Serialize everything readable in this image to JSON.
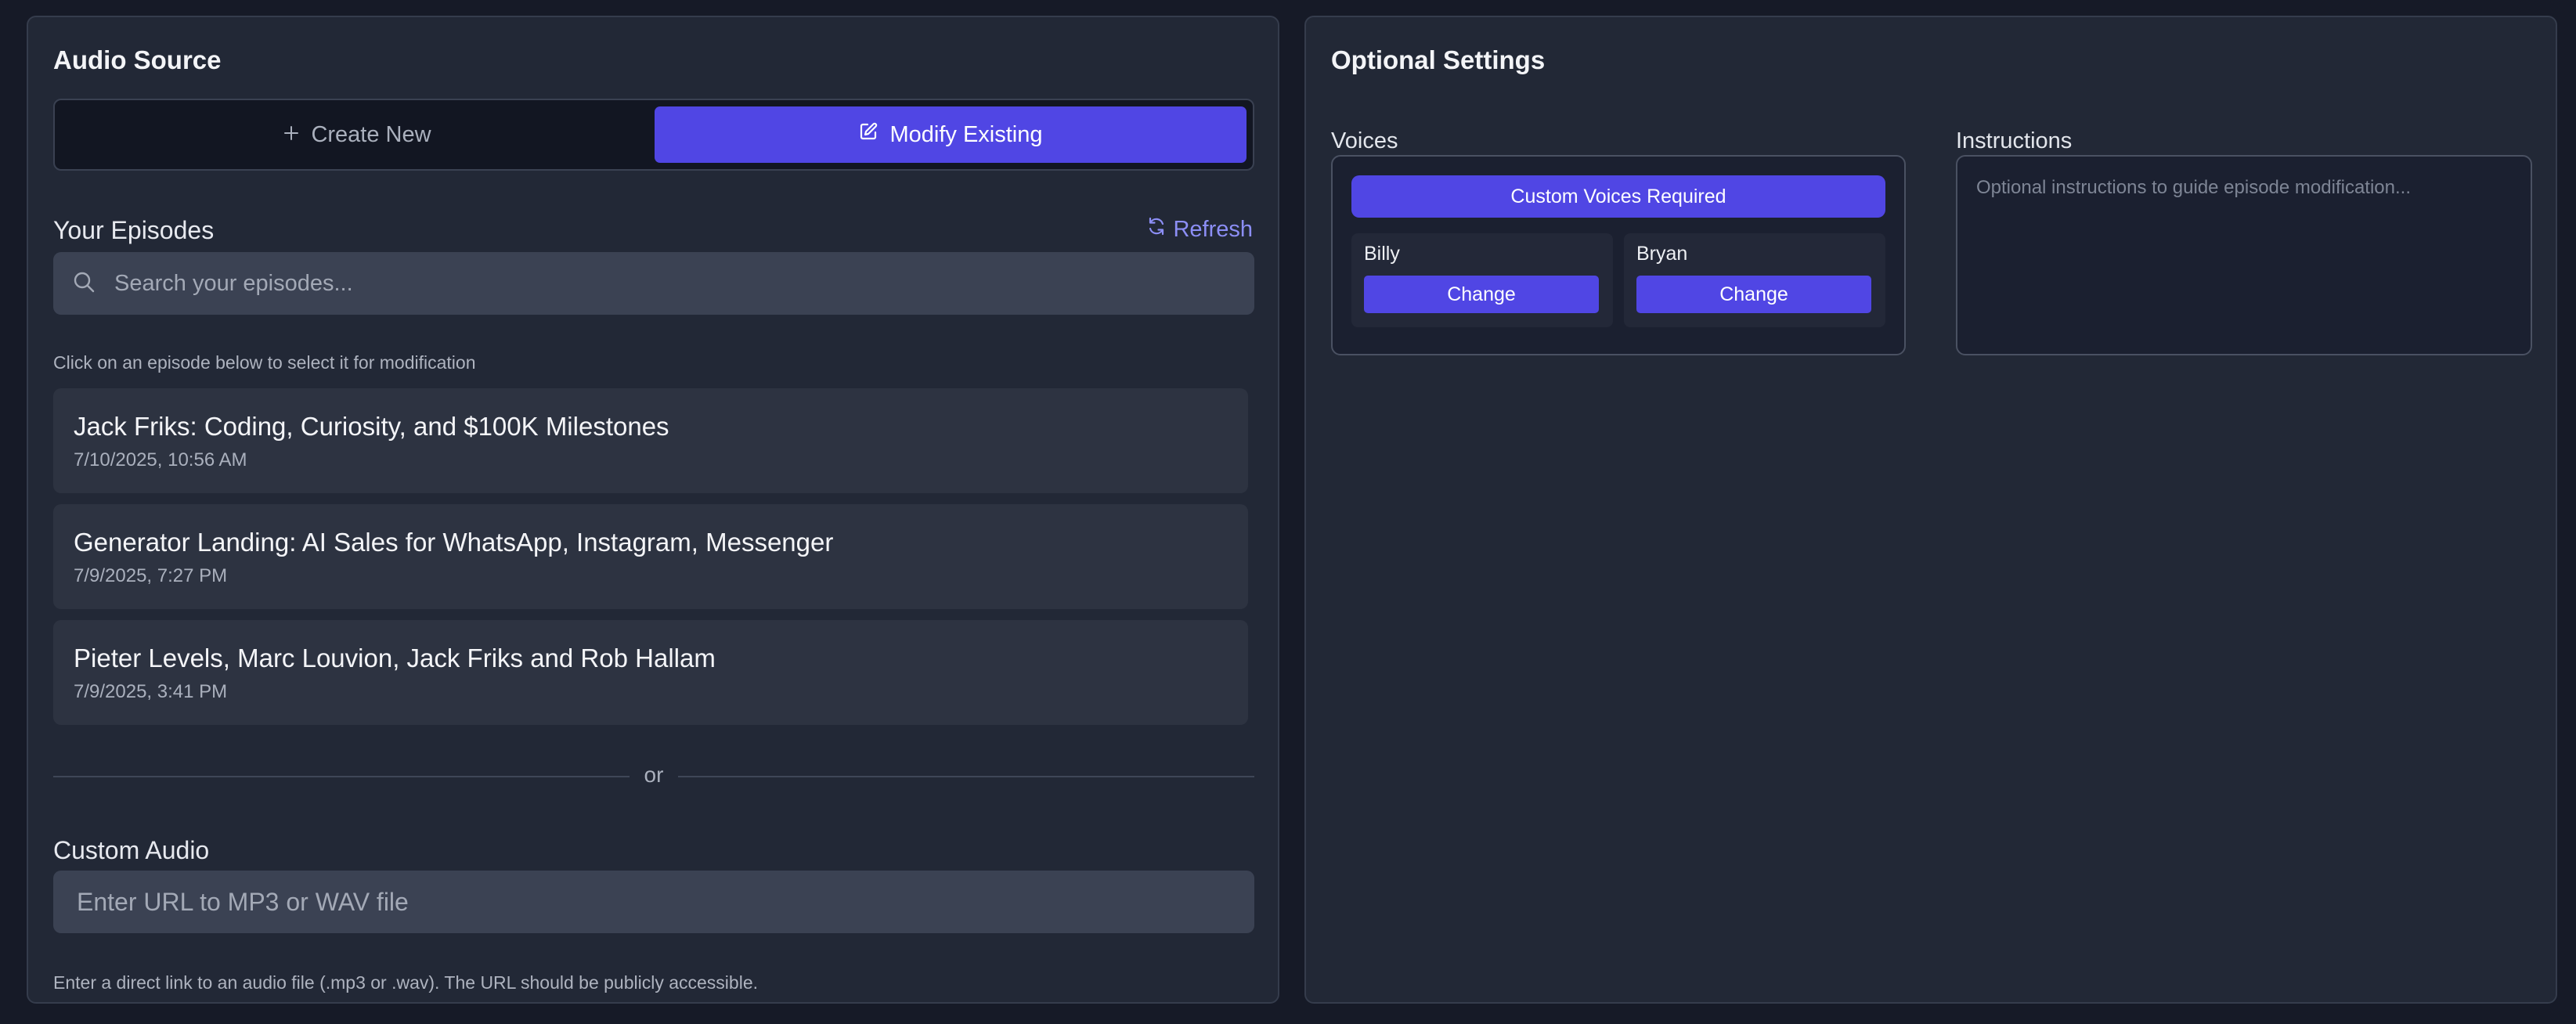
{
  "audio_source": {
    "title": "Audio Source",
    "toggle": {
      "create_new": "Create New",
      "modify_existing": "Modify Existing"
    },
    "episodes": {
      "heading": "Your Episodes",
      "refresh_label": "Refresh",
      "search_placeholder": "Search your episodes...",
      "hint": "Click on an episode below to select it for modification",
      "items": [
        {
          "title": "Jack Friks: Coding, Curiosity, and $100K Milestones",
          "date": "7/10/2025, 10:56 AM"
        },
        {
          "title": "Generator Landing: AI Sales for WhatsApp, Instagram, Messenger",
          "date": "7/9/2025, 7:27 PM"
        },
        {
          "title": "Pieter Levels, Marc Louvion, Jack Friks and Rob Hallam",
          "date": "7/9/2025, 3:41 PM"
        }
      ]
    },
    "divider_text": "or",
    "custom_audio": {
      "heading": "Custom Audio",
      "placeholder": "Enter URL to MP3 or WAV file",
      "hint": "Enter a direct link to an audio file (.mp3 or .wav). The URL should be publicly accessible."
    }
  },
  "optional_settings": {
    "title": "Optional Settings",
    "voices": {
      "label": "Voices",
      "custom_voices_button": "Custom Voices Required",
      "items": [
        {
          "name": "Billy",
          "change_label": "Change"
        },
        {
          "name": "Bryan",
          "change_label": "Change"
        }
      ]
    },
    "instructions": {
      "label": "Instructions",
      "placeholder": "Optional instructions to guide episode modification..."
    }
  },
  "colors": {
    "accent": "#5046e4",
    "background": "#161a27",
    "panel": "#222836",
    "link": "#8c8ef5"
  },
  "icons": {
    "create": "plus-icon",
    "modify": "edit-icon",
    "refresh": "refresh-icon",
    "search": "search-icon"
  }
}
